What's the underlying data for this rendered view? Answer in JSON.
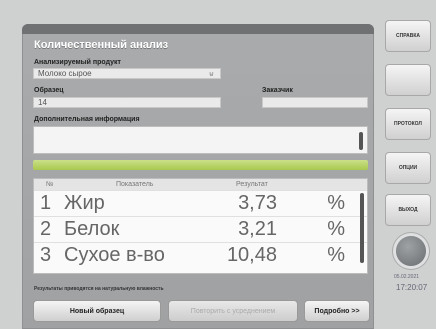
{
  "panel": {
    "title": "Количественный анализ",
    "product_label": "Анализируемый продукт",
    "product_value": "Молоко сырое",
    "sample_label": "Образец",
    "sample_value": "14",
    "customer_label": "Заказчик",
    "customer_value": "",
    "info_label": "Дополнительная информация",
    "info_value": ""
  },
  "table": {
    "headers": [
      "№",
      "Показатель",
      "Результат"
    ],
    "rows": [
      {
        "n": "1",
        "name": "Жир",
        "value": "3,73",
        "unit": "%"
      },
      {
        "n": "2",
        "name": "Белок",
        "value": "3,21",
        "unit": "%"
      },
      {
        "n": "3",
        "name": "Сухое в-во",
        "value": "10,48",
        "unit": "%"
      }
    ]
  },
  "note": "Результаты приводятся на натуральную влажность",
  "buttons": {
    "new_sample": "Новый образец",
    "repeat": "Повторить с усреднением",
    "details": "Подробно >>"
  },
  "sidebar": {
    "help": "СПРАВКА",
    "blank": "",
    "protocol": "ПРОТОКОЛ",
    "options": "ОПЦИИ",
    "exit": "ВЫХОД"
  },
  "clock": {
    "date": "05.02.2021",
    "time": "17:20:07"
  },
  "colors": {
    "accent_green": "#a9c94e",
    "panel_gray": "#a9abad"
  }
}
